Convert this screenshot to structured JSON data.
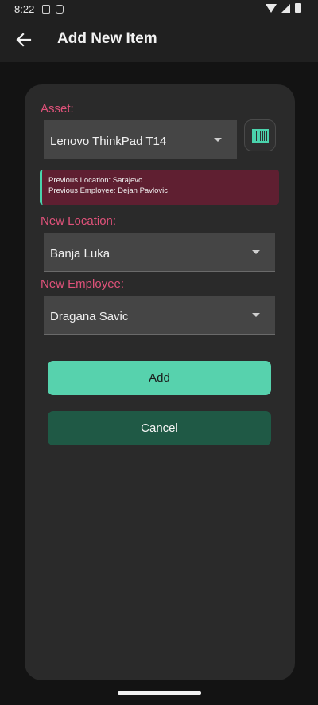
{
  "status_bar": {
    "time": "8:22",
    "icons": [
      "app-notification-icon",
      "app-notification-icon",
      "wifi-icon",
      "signal-icon",
      "battery-icon"
    ]
  },
  "app_bar": {
    "title": "Add New Item",
    "back_icon": "arrow-left-icon"
  },
  "form": {
    "asset": {
      "label": "Asset:",
      "value": "Lenovo ThinkPad T14",
      "scan_icon": "barcode-icon"
    },
    "previous": {
      "location_line": "Previous Location: Sarajevo",
      "employee_line": "Previous Employee: Dejan Pavlovic"
    },
    "new_location": {
      "label": "New Location:",
      "value": "Banja Luka"
    },
    "new_employee": {
      "label": "New Employee:",
      "value": "Dragana Savic"
    },
    "add_label": "Add",
    "cancel_label": "Cancel"
  },
  "colors": {
    "accent_label": "#e0527a",
    "add_button": "#57d2ad",
    "cancel_button": "#1f5945",
    "info_background": "#5f1f31",
    "card_background": "#2a2a2a"
  }
}
